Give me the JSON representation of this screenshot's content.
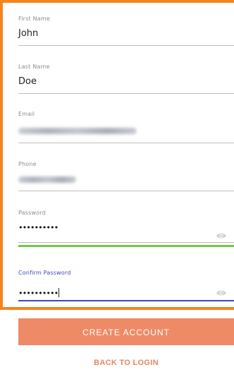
{
  "form": {
    "first_name": {
      "label": "First Name",
      "value": "John"
    },
    "last_name": {
      "label": "Last Name",
      "value": "Doe"
    },
    "email": {
      "label": "Email",
      "value": ""
    },
    "phone": {
      "label": "Phone",
      "value": ""
    },
    "password": {
      "label": "Password",
      "value": "••••••••••"
    },
    "confirm_password": {
      "label": "Confirm Password",
      "value": "••••••••••"
    }
  },
  "actions": {
    "create_label": "CREATE ACCOUNT",
    "back_label": "BACK TO LOGIN"
  },
  "colors": {
    "frame_border": "#f5841f",
    "button_bg": "#ef8a66",
    "link": "#e58660",
    "strength_bar": "#72c74a",
    "focus_accent": "#3b4bb5"
  },
  "icons": {
    "password_toggle": "eye-icon",
    "confirm_password_toggle": "eye-icon"
  }
}
